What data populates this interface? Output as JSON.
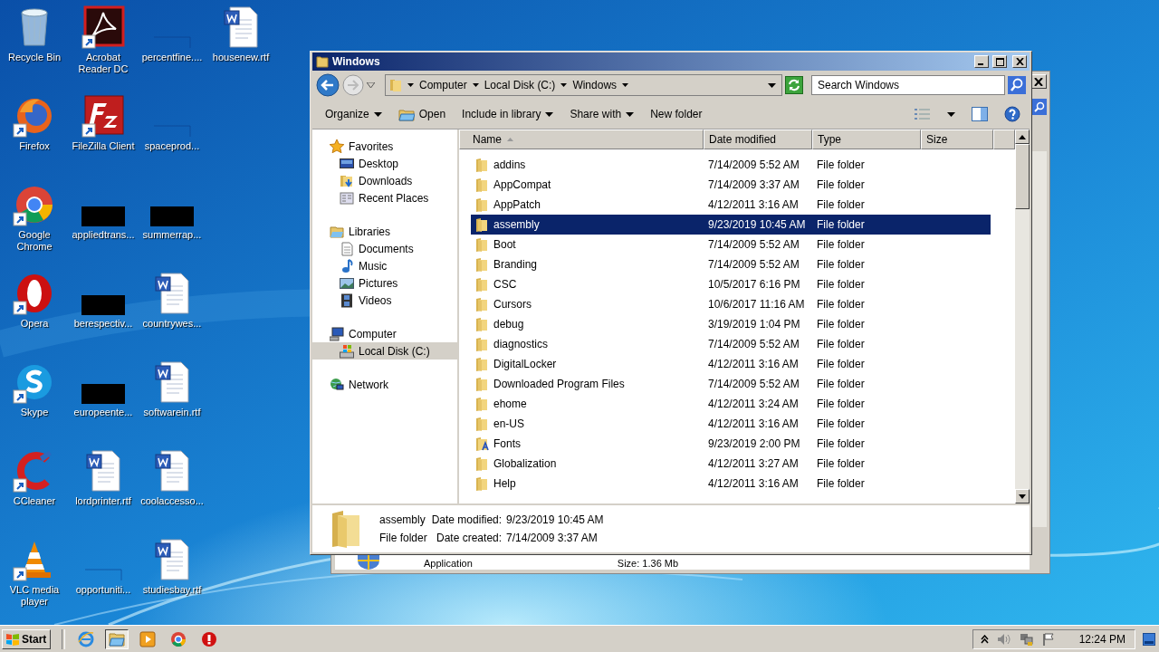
{
  "desktop": {
    "columns": [
      [
        {
          "label": "Recycle Bin",
          "kind": "bin",
          "shortcut": false
        },
        {
          "label": "Firefox",
          "kind": "firefox",
          "shortcut": true
        },
        {
          "label": "Google Chrome",
          "kind": "chrome",
          "shortcut": true
        },
        {
          "label": "Opera",
          "kind": "opera",
          "shortcut": true
        },
        {
          "label": "Skype",
          "kind": "skype",
          "shortcut": true
        },
        {
          "label": "CCleaner",
          "kind": "ccleaner",
          "shortcut": true
        },
        {
          "label": "VLC media player",
          "kind": "vlc",
          "shortcut": true
        }
      ],
      [
        {
          "label": "Acrobat Reader DC",
          "kind": "pdf",
          "shortcut": true
        },
        {
          "label": "FileZilla Client",
          "kind": "filezilla",
          "shortcut": true
        },
        {
          "label": "appliedtrans...",
          "kind": "redacted",
          "shortcut": false
        },
        {
          "label": "berespectiv...",
          "kind": "redacted",
          "shortcut": false
        },
        {
          "label": "europeente...",
          "kind": "redacted",
          "shortcut": false
        },
        {
          "label": "lordprinter.rtf",
          "kind": "word",
          "shortcut": false
        },
        {
          "label": "opportuniti...",
          "kind": "blank",
          "shortcut": false
        }
      ],
      [
        {
          "label": "percentfine....",
          "kind": "blank",
          "shortcut": false
        },
        {
          "label": "spaceprod...",
          "kind": "blank",
          "shortcut": false
        },
        {
          "label": "summerrap...",
          "kind": "redacted",
          "shortcut": false
        },
        {
          "label": "countrywes...",
          "kind": "word",
          "shortcut": false
        },
        {
          "label": "softwarein.rtf",
          "kind": "word",
          "shortcut": false
        },
        {
          "label": "coolaccesso...",
          "kind": "word",
          "shortcut": false
        },
        {
          "label": "studiesbay.rtf",
          "kind": "word",
          "shortcut": false
        }
      ],
      [
        {
          "label": "housenew.rtf",
          "kind": "word",
          "shortcut": false
        }
      ]
    ]
  },
  "back_window": {
    "type": "Application",
    "size": "Size: 1.36 Mb"
  },
  "window": {
    "title": "Windows",
    "address": {
      "crumbs": [
        "Computer",
        "Local Disk (C:)",
        "Windows"
      ]
    },
    "search": {
      "placeholder": "Search Windows"
    },
    "commands": [
      {
        "label": "Organize",
        "menu": true,
        "icon": false
      },
      {
        "label": "Open",
        "menu": false,
        "icon": true
      },
      {
        "label": "Include in library",
        "menu": true,
        "icon": false
      },
      {
        "label": "Share with",
        "menu": true,
        "icon": false
      },
      {
        "label": "New folder",
        "menu": false,
        "icon": false
      }
    ],
    "navigation": {
      "groups": [
        {
          "label": "Favorites",
          "kind": "star",
          "selected": false,
          "children": [
            {
              "label": "Desktop",
              "kind": "desktop",
              "selected": false
            },
            {
              "label": "Downloads",
              "kind": "downloads",
              "selected": false
            },
            {
              "label": "Recent Places",
              "kind": "recent",
              "selected": false
            }
          ]
        },
        {
          "label": "Libraries",
          "kind": "libraries",
          "selected": false,
          "children": [
            {
              "label": "Documents",
              "kind": "documents",
              "selected": false
            },
            {
              "label": "Music",
              "kind": "music",
              "selected": false
            },
            {
              "label": "Pictures",
              "kind": "pictures",
              "selected": false
            },
            {
              "label": "Videos",
              "kind": "videos",
              "selected": false
            }
          ]
        },
        {
          "label": "Computer",
          "kind": "computer",
          "selected": false,
          "children": [
            {
              "label": "Local Disk (C:)",
              "kind": "disk",
              "selected": true
            }
          ]
        },
        {
          "label": "Network",
          "kind": "network",
          "selected": false
        }
      ]
    },
    "files": {
      "columns": [
        {
          "label": "Name",
          "sorted": true
        },
        {
          "label": "Date modified",
          "sorted": false
        },
        {
          "label": "Type",
          "sorted": false
        },
        {
          "label": "Size",
          "sorted": false
        }
      ],
      "rows": [
        {
          "name": "addins",
          "date": "7/14/2009 5:52 AM",
          "type": "File folder",
          "kind": "folder",
          "selected": false
        },
        {
          "name": "AppCompat",
          "date": "7/14/2009 3:37 AM",
          "type": "File folder",
          "kind": "folder",
          "selected": false
        },
        {
          "name": "AppPatch",
          "date": "4/12/2011 3:16 AM",
          "type": "File folder",
          "kind": "folder",
          "selected": false
        },
        {
          "name": "assembly",
          "date": "9/23/2019 10:45 AM",
          "type": "File folder",
          "kind": "folder",
          "selected": true
        },
        {
          "name": "Boot",
          "date": "7/14/2009 5:52 AM",
          "type": "File folder",
          "kind": "folder",
          "selected": false
        },
        {
          "name": "Branding",
          "date": "7/14/2009 5:52 AM",
          "type": "File folder",
          "kind": "folder",
          "selected": false
        },
        {
          "name": "CSC",
          "date": "10/5/2017 6:16 PM",
          "type": "File folder",
          "kind": "folder",
          "selected": false
        },
        {
          "name": "Cursors",
          "date": "10/6/2017 11:16 AM",
          "type": "File folder",
          "kind": "folder",
          "selected": false
        },
        {
          "name": "debug",
          "date": "3/19/2019 1:04 PM",
          "type": "File folder",
          "kind": "folder",
          "selected": false
        },
        {
          "name": "diagnostics",
          "date": "7/14/2009 5:52 AM",
          "type": "File folder",
          "kind": "folder",
          "selected": false
        },
        {
          "name": "DigitalLocker",
          "date": "4/12/2011 3:16 AM",
          "type": "File folder",
          "kind": "folder",
          "selected": false
        },
        {
          "name": "Downloaded Program Files",
          "date": "7/14/2009 5:52 AM",
          "type": "File folder",
          "kind": "folder",
          "selected": false
        },
        {
          "name": "ehome",
          "date": "4/12/2011 3:24 AM",
          "type": "File folder",
          "kind": "folder",
          "selected": false
        },
        {
          "name": "en-US",
          "date": "4/12/2011 3:16 AM",
          "type": "File folder",
          "kind": "folder",
          "selected": false
        },
        {
          "name": "Fonts",
          "date": "9/23/2019 2:00 PM",
          "type": "File folder",
          "kind": "fonts",
          "selected": false
        },
        {
          "name": "Globalization",
          "date": "4/12/2011 3:27 AM",
          "type": "File folder",
          "kind": "folder",
          "selected": false
        },
        {
          "name": "Help",
          "date": "4/12/2011 3:16 AM",
          "type": "File folder",
          "kind": "folder",
          "selected": false
        }
      ]
    },
    "details": {
      "name": "assembly",
      "type": "File folder",
      "fields": [
        {
          "label": "Date modified:",
          "value": "9/23/2019 10:45 AM"
        },
        {
          "label": "Date created:",
          "value": "7/14/2009 3:37 AM"
        }
      ]
    }
  },
  "taskbar": {
    "start": "Start",
    "apps": [
      {
        "kind": "ie",
        "active": false
      },
      {
        "kind": "explorer",
        "active": true
      },
      {
        "kind": "media",
        "active": false
      },
      {
        "kind": "chrome",
        "active": false
      },
      {
        "kind": "stop",
        "active": false
      }
    ],
    "time": "12:24 PM"
  }
}
